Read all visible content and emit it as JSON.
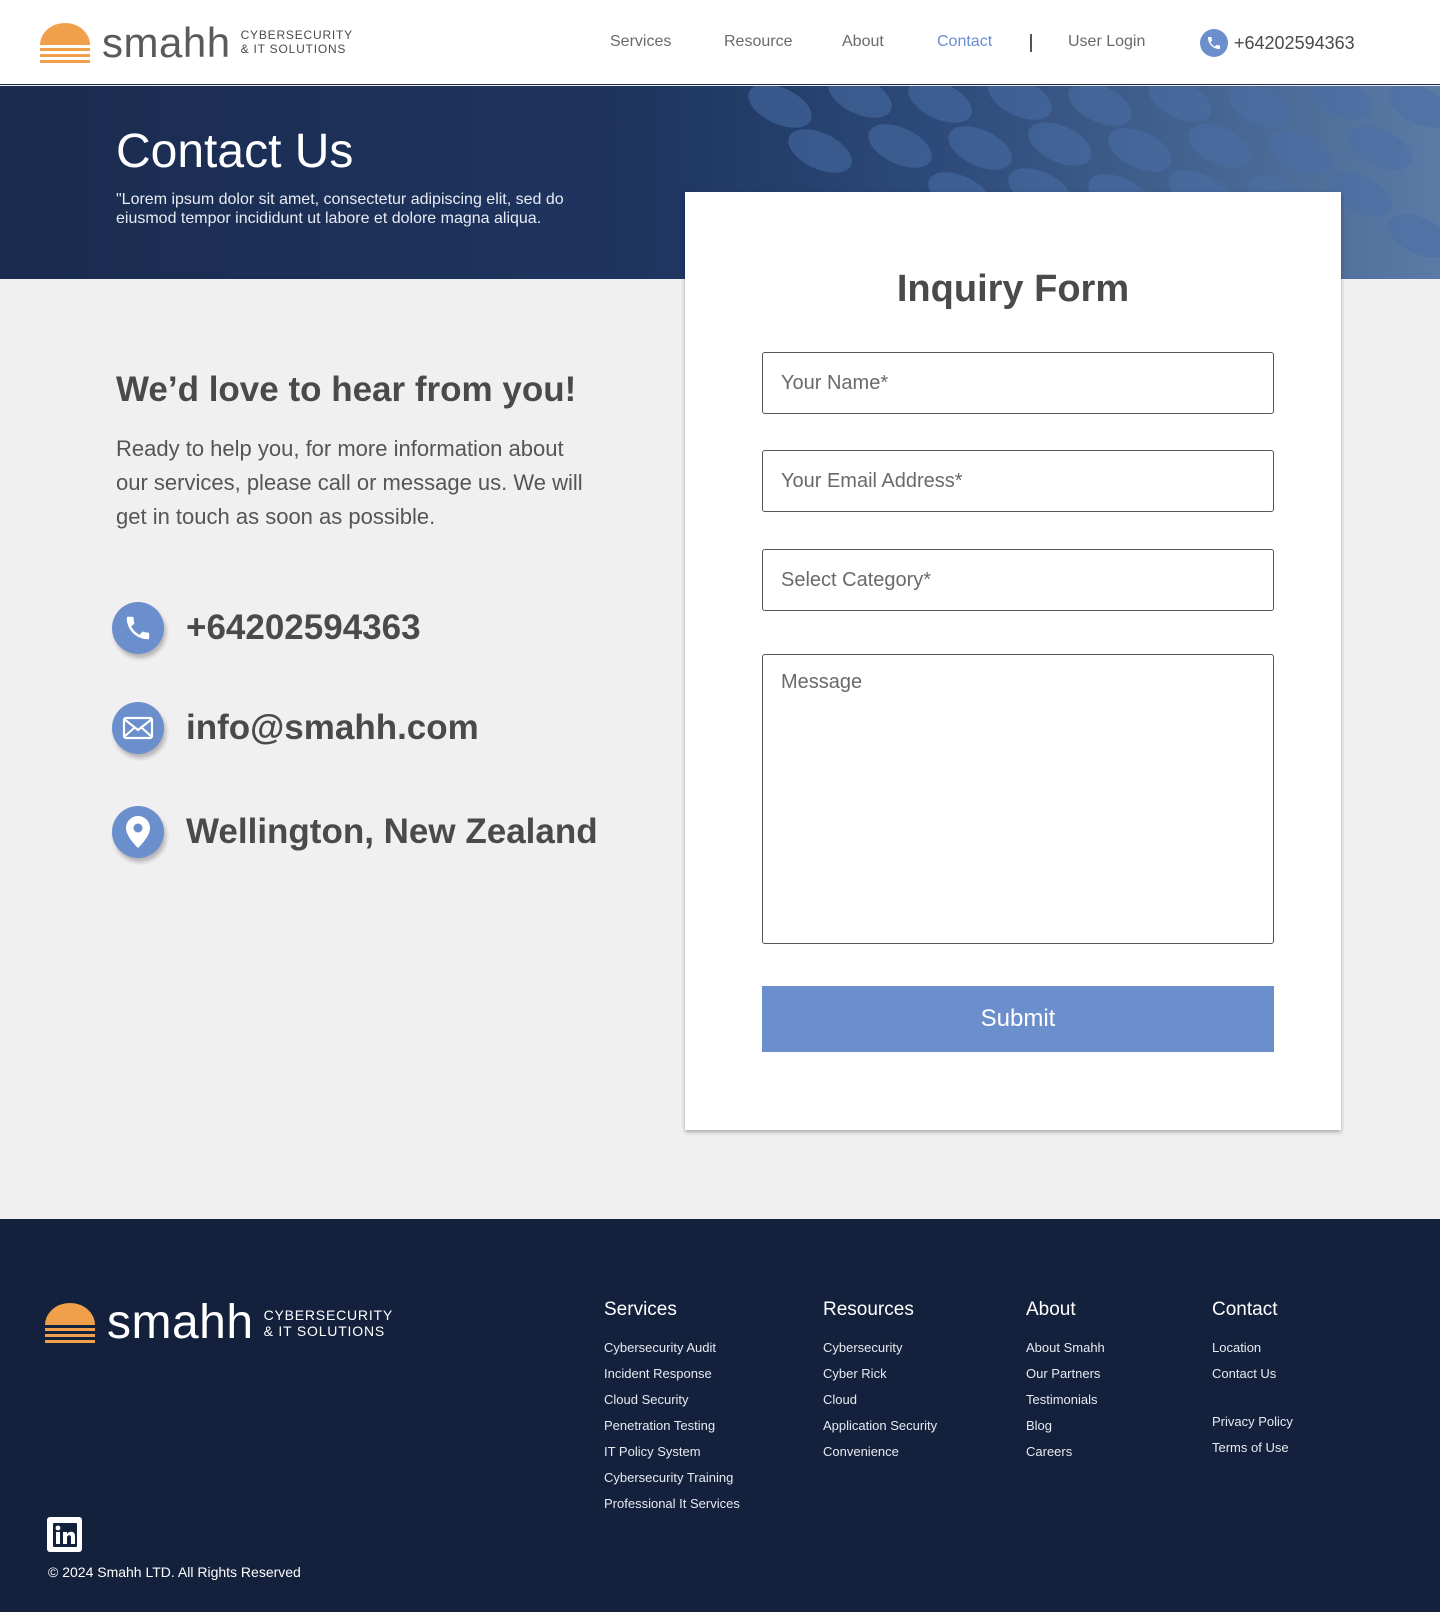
{
  "brand": {
    "name": "smahh",
    "tagline_line1": "CYBERSECURITY",
    "tagline_line2": "& IT SOLUTIONS",
    "sun_color": "#f0a04b"
  },
  "nav": {
    "items": [
      "Services",
      "Resource",
      "About",
      "Contact"
    ],
    "active": "Contact",
    "login": "User Login",
    "phone": "+64202594363"
  },
  "hero": {
    "title": "Contact Us",
    "text": "\"Lorem ipsum dolor sit amet, consectetur adipiscing elit, sed do eiusmod tempor incididunt ut labore et dolore magna aliqua."
  },
  "intro": {
    "heading": "We’d love to hear from you!",
    "body": "Ready to help you, for more information about our services, please call  or message us. We will get in touch as soon as possible."
  },
  "contact": {
    "phone": "+64202594363",
    "email": "info@smahh.com",
    "location": "Wellington, New Zealand"
  },
  "form": {
    "title": "Inquiry Form",
    "name_placeholder": "Your Name*",
    "email_placeholder": "Your Email Address*",
    "category_placeholder": "Select Category*",
    "message_placeholder": "Message",
    "submit": "Submit"
  },
  "footer": {
    "columns": [
      {
        "title": "Services",
        "links": [
          "Cybersecurity Audit",
          "Incident Response",
          "Cloud Security",
          "Penetration Testing",
          "IT Policy System",
          "Cybersecurity Training",
          "Professional It Services"
        ]
      },
      {
        "title": "Resources",
        "links": [
          "Cybersecurity",
          "Cyber Rick",
          "Cloud",
          "Application Security",
          "Convenience"
        ]
      },
      {
        "title": "About",
        "links": [
          "About Smahh",
          "Our Partners",
          "Testimonials",
          "Blog",
          "Careers"
        ]
      },
      {
        "title": "Contact",
        "links": [
          "Location",
          "Contact Us"
        ],
        "extra_links": [
          "Privacy Policy",
          "Terms of Use"
        ]
      }
    ],
    "copyright": "© 2024 Smahh LTD.  All Rights Reserved",
    "social": "linkedin-icon"
  },
  "colors": {
    "accent": "#6a8fcc",
    "navy": "#14213d",
    "orange": "#f0a04b"
  }
}
